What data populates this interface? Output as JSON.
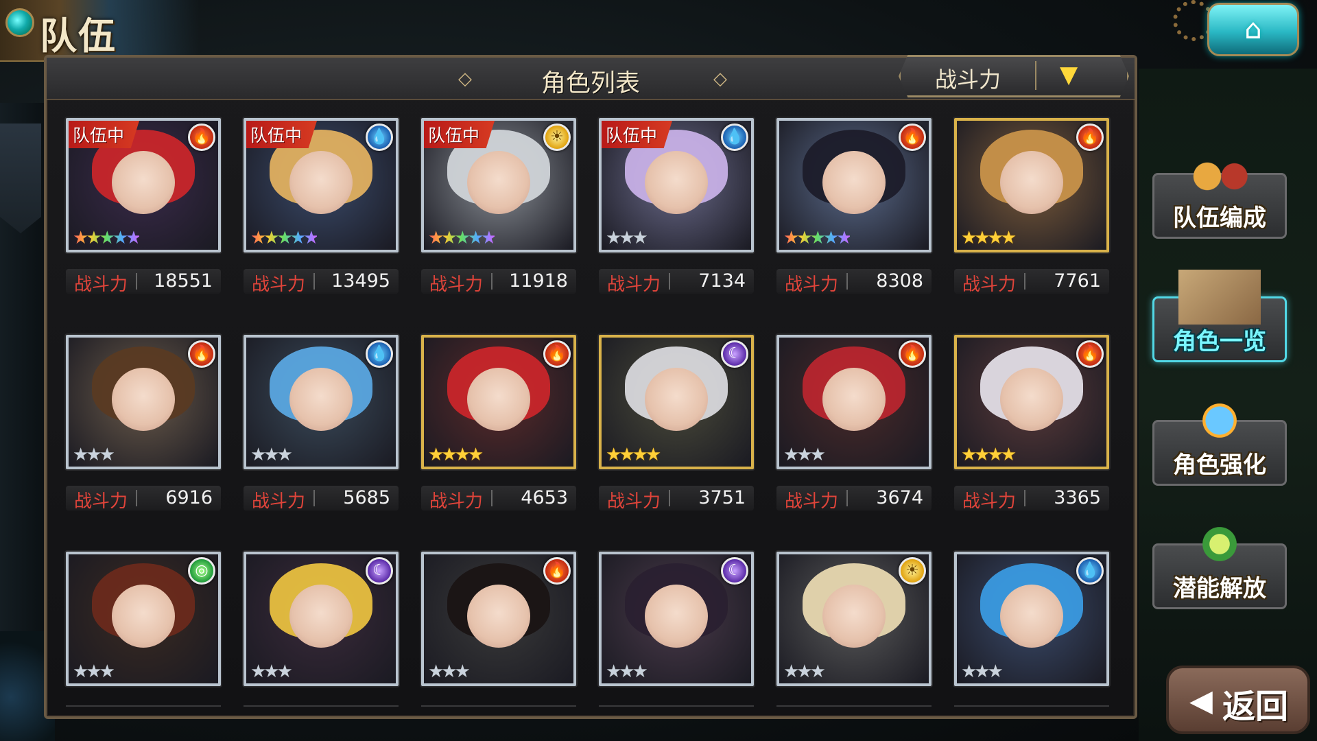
{
  "screen": {
    "title": "队伍"
  },
  "header": {
    "title": "角色列表",
    "sort_label": "战斗力"
  },
  "power_label": "战斗力",
  "team_tag": "队伍中",
  "characters": [
    {
      "team": true,
      "element": "fire",
      "stars": 5,
      "star_style": "rainbow",
      "frame": "silver",
      "power": "18551",
      "hair": "#c8262a",
      "bg": "#3a2a4a"
    },
    {
      "team": true,
      "element": "water",
      "stars": 5,
      "star_style": "rainbow",
      "frame": "silver",
      "power": "13495",
      "hair": "#e0b060",
      "bg": "#3a4a6a"
    },
    {
      "team": true,
      "element": "light",
      "stars": 5,
      "star_style": "rainbow",
      "frame": "silver",
      "power": "11918",
      "hair": "#d0d4d8",
      "bg": "#8a8f96"
    },
    {
      "team": true,
      "element": "water",
      "stars": 3,
      "star_style": "silver",
      "frame": "silver",
      "power": "7134",
      "hair": "#c7b0e6",
      "bg": "#6a6a8a"
    },
    {
      "team": false,
      "element": "fire",
      "stars": 5,
      "star_style": "rainbow",
      "frame": "silver",
      "power": "8308",
      "hair": "#1c1c2a",
      "bg": "#5a6a8a"
    },
    {
      "team": false,
      "element": "fire",
      "stars": 4,
      "star_style": "gold",
      "frame": "gold",
      "power": "7761",
      "hair": "#c8924a",
      "bg": "#7a5a3a"
    },
    {
      "team": false,
      "element": "fire",
      "stars": 3,
      "star_style": "silver",
      "frame": "silver",
      "power": "6916",
      "hair": "#5a3a22",
      "bg": "#6a5a4a"
    },
    {
      "team": false,
      "element": "water",
      "stars": 3,
      "star_style": "silver",
      "frame": "silver",
      "power": "5685",
      "hair": "#5aa6e0",
      "bg": "#3a4a5a"
    },
    {
      "team": false,
      "element": "fire",
      "stars": 4,
      "star_style": "gold",
      "frame": "gold",
      "power": "4653",
      "hair": "#c8262a",
      "bg": "#5a2a2a"
    },
    {
      "team": false,
      "element": "dark",
      "stars": 4,
      "star_style": "gold",
      "frame": "gold",
      "power": "3751",
      "hair": "#d8d8dc",
      "bg": "#4a4a3a"
    },
    {
      "team": false,
      "element": "fire",
      "stars": 3,
      "star_style": "silver",
      "frame": "silver",
      "power": "3674",
      "hair": "#b8262e",
      "bg": "#4a2a2a"
    },
    {
      "team": false,
      "element": "fire",
      "stars": 4,
      "star_style": "gold",
      "frame": "gold",
      "power": "3365",
      "hair": "#e2dde6",
      "bg": "#5a3a3a"
    },
    {
      "team": false,
      "element": "wind",
      "stars": 3,
      "star_style": "silver",
      "frame": "silver",
      "power": "",
      "hair": "#6a2a1c",
      "bg": "#3a2a22"
    },
    {
      "team": false,
      "element": "dark",
      "stars": 3,
      "star_style": "silver",
      "frame": "silver",
      "power": "",
      "hair": "#e8c040",
      "bg": "#3a2a3a"
    },
    {
      "team": false,
      "element": "fire",
      "stars": 3,
      "star_style": "silver",
      "frame": "silver",
      "power": "",
      "hair": "#1a1414",
      "bg": "#3a3a3a"
    },
    {
      "team": false,
      "element": "dark",
      "stars": 3,
      "star_style": "silver",
      "frame": "silver",
      "power": "",
      "hair": "#2a2030",
      "bg": "#4a3a4a"
    },
    {
      "team": false,
      "element": "light",
      "stars": 3,
      "star_style": "silver",
      "frame": "silver",
      "power": "",
      "hair": "#e8d8b0",
      "bg": "#5a5a5a"
    },
    {
      "team": false,
      "element": "water",
      "stars": 3,
      "star_style": "silver",
      "frame": "silver",
      "power": "",
      "hair": "#3a9ae0",
      "bg": "#3a4a6a"
    }
  ],
  "side_menu": [
    {
      "label": "队伍编成",
      "active": false,
      "icon": "team-icon"
    },
    {
      "label": "角色一览",
      "active": true,
      "icon": "book-icon"
    },
    {
      "label": "角色强化",
      "active": false,
      "icon": "card-upgrade-icon"
    },
    {
      "label": "潜能解放",
      "active": false,
      "icon": "orb-icon"
    }
  ],
  "back_label": "返回",
  "colors": {
    "team_red": "#d63a22",
    "active_cyan": "#52d8e6",
    "power_red": "#e0443a"
  }
}
